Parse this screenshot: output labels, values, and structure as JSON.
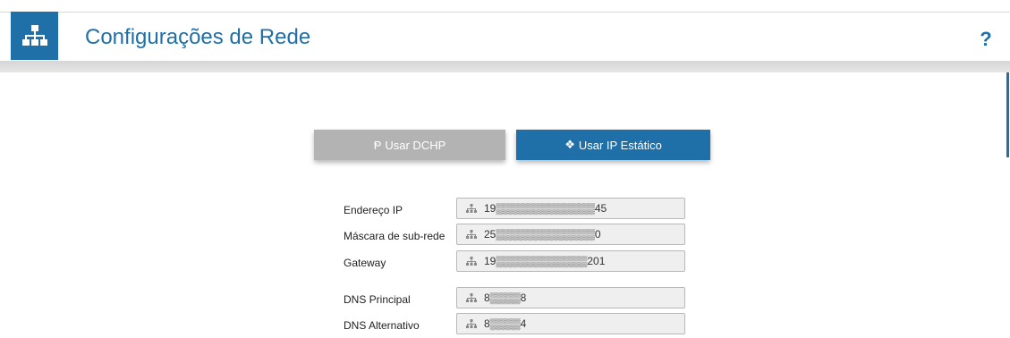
{
  "header": {
    "title": "Configurações de Rede",
    "help_label": "?",
    "icon": "network-icon"
  },
  "mode_buttons": {
    "dhcp": {
      "icon": "dhcp-icon",
      "label": "Usar DCHP",
      "icon_glyph": "Ᵽ"
    },
    "static": {
      "icon": "static-ip-icon",
      "label": "Usar IP Estático",
      "icon_glyph": "❖"
    }
  },
  "fields": [
    {
      "label": "Endereço IP",
      "value": "19▒▒▒▒▒▒▒▒▒▒▒▒▒45"
    },
    {
      "label": "Máscara de sub-rede",
      "value": "25▒▒▒▒▒▒▒▒▒▒▒▒▒0"
    },
    {
      "label": "Gateway",
      "value": "19▒▒▒▒▒▒▒▒▒▒▒▒201"
    },
    {
      "label": "DNS Principal",
      "value": "8▒▒▒▒8"
    },
    {
      "label": "DNS Alternativo",
      "value": "8▒▒▒▒4"
    }
  ],
  "colors": {
    "accent": "#1f6fa8",
    "disabled_button": "#b3b3b3",
    "field_bg": "#efefef"
  }
}
